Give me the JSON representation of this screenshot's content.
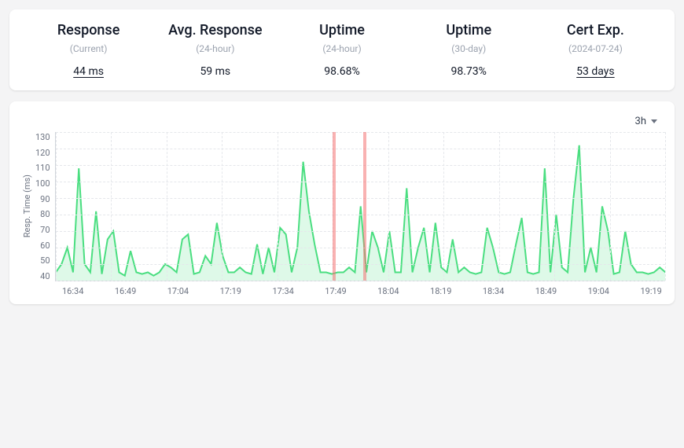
{
  "stats": [
    {
      "title": "Response",
      "sub": "(Current)",
      "value": "44 ms",
      "underline": true
    },
    {
      "title": "Avg. Response",
      "sub": "(24-hour)",
      "value": "59 ms",
      "underline": false
    },
    {
      "title": "Uptime",
      "sub": "(24-hour)",
      "value": "98.68%",
      "underline": false
    },
    {
      "title": "Uptime",
      "sub": "(30-day)",
      "value": "98.73%",
      "underline": false
    },
    {
      "title": "Cert Exp.",
      "sub": "(2024-07-24)",
      "value": "53 days",
      "underline": true
    }
  ],
  "chart": {
    "range_label": "3h",
    "y_label": "Resp. Time (ms)",
    "y_ticks": [
      "130",
      "120",
      "110",
      "100",
      "90",
      "80",
      "70",
      "60",
      "50",
      "40"
    ],
    "x_ticks": [
      "16:34",
      "16:49",
      "17:04",
      "17:19",
      "17:34",
      "17:49",
      "18:04",
      "18:19",
      "18:34",
      "18:49",
      "19:04",
      "19:19"
    ],
    "ylim": [
      40,
      130
    ],
    "outages": [
      {
        "x_frac": 0.455
      },
      {
        "x_frac": 0.505
      }
    ]
  },
  "chart_data": {
    "type": "line",
    "title": "",
    "xlabel": "",
    "ylabel": "Resp. Time (ms)",
    "ylim": [
      40,
      130
    ],
    "x_categories": [
      "16:34",
      "16:49",
      "17:04",
      "17:19",
      "17:34",
      "17:49",
      "18:04",
      "18:19",
      "18:34",
      "18:49",
      "19:04",
      "19:19"
    ],
    "series": [
      {
        "name": "response_time_ms",
        "color": "#4ade80",
        "values": [
          45,
          50,
          60,
          45,
          108,
          50,
          45,
          82,
          44,
          65,
          70,
          45,
          43,
          58,
          45,
          44,
          45,
          43,
          45,
          50,
          48,
          45,
          65,
          68,
          44,
          45,
          55,
          50,
          75,
          55,
          45,
          45,
          48,
          45,
          44,
          62,
          44,
          60,
          45,
          72,
          68,
          45,
          60,
          112,
          82,
          62,
          45,
          45,
          44,
          45,
          45,
          48,
          45,
          85,
          45,
          70,
          60,
          45,
          70,
          45,
          45,
          96,
          45,
          60,
          72,
          45,
          75,
          48,
          45,
          65,
          45,
          48,
          45,
          44,
          45,
          72,
          60,
          45,
          44,
          45,
          62,
          78,
          45,
          44,
          45,
          108,
          45,
          80,
          48,
          45,
          90,
          122,
          45,
          60,
          45,
          85,
          70,
          44,
          45,
          70,
          50,
          45,
          45,
          44,
          45,
          48,
          45
        ]
      }
    ],
    "annotations": {
      "outage_markers_time": [
        "17:52",
        "18:05"
      ]
    }
  }
}
